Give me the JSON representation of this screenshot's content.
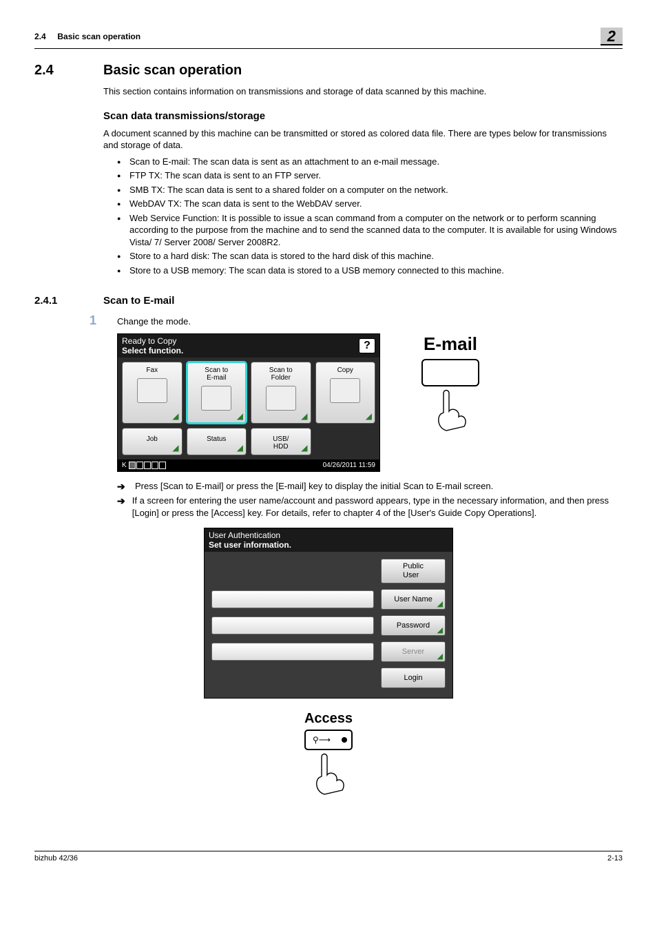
{
  "running_header": {
    "section_num": "2.4",
    "section_title": "Basic scan operation",
    "chapter_badge": "2"
  },
  "h1": {
    "num": "2.4",
    "title": "Basic scan operation",
    "intro": "This section contains information on transmissions and storage of data scanned by this machine."
  },
  "h2": {
    "title": "Scan data transmissions/storage",
    "intro": "A document scanned by this machine can be transmitted or stored as colored data file. There are types below for transmissions and storage of data.",
    "bullets": [
      "Scan to E-mail: The scan data is sent as an attachment to an e-mail message.",
      "FTP TX: The scan data is sent to an FTP server.",
      "SMB TX: The scan data is sent to a shared folder on a computer on the network.",
      "WebDAV TX: The scan data is sent to the WebDAV server.",
      "Web Service Function: It is possible to issue a scan command from a computer on the network or to perform scanning according to the purpose from the machine and to send the scanned data to the computer. It is available for using Windows Vista/ 7/ Server 2008/ Server 2008R2.",
      "Store to a hard disk: The scan data is stored to the hard disk of this machine.",
      "Store to a USB memory: The scan data is stored to a USB memory connected to this machine."
    ]
  },
  "h3": {
    "num": "2.4.1",
    "title": "Scan to E-mail"
  },
  "step1": {
    "num": "1",
    "text": "Change the mode."
  },
  "screen1": {
    "line1": "Ready to Copy",
    "line2": "Select function.",
    "help": "?",
    "tiles": {
      "fax": "Fax",
      "scan_email": "Scan to\nE-mail",
      "scan_folder": "Scan to\nFolder",
      "copy": "Copy",
      "job": "Job",
      "status": "Status",
      "usb_hdd": "USB/\nHDD"
    },
    "toner_label": "K",
    "timestamp": "04/26/2011 11:59"
  },
  "keycap_email": "E-mail",
  "sub_arrows": [
    "Press [Scan to E-mail] or press the [E-mail] key to display the initial Scan to E-mail screen.",
    "If a screen for entering the user name/account and password appears, type in the necessary information, and then press [Login] or press the [Access] key. For details, refer to chapter 4 of the [User's Guide Copy Operations]."
  ],
  "screen2": {
    "line1": "User Authentication",
    "line2": "Set user information.",
    "buttons": {
      "public_user": "Public\nUser",
      "user_name": "User Name",
      "password": "Password",
      "server": "Server",
      "login": "Login"
    }
  },
  "keycap_access": "Access",
  "footer": {
    "left": "bizhub 42/36",
    "right": "2-13"
  }
}
